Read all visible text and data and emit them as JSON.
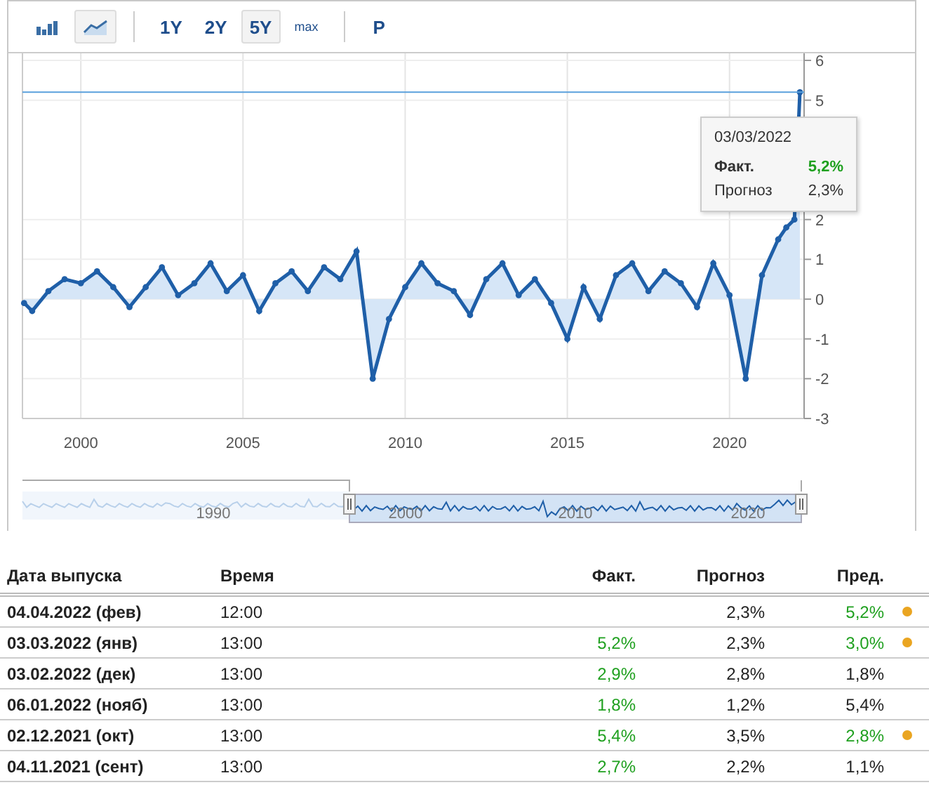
{
  "toolbar": {
    "chart_types": [
      {
        "kind": "bars",
        "selected": false
      },
      {
        "kind": "line",
        "selected": true
      }
    ],
    "ranges": [
      {
        "label": "1Y",
        "selected": false
      },
      {
        "label": "2Y",
        "selected": false
      },
      {
        "label": "5Y",
        "selected": true
      },
      {
        "label": "max",
        "selected": false,
        "kind": "small"
      }
    ],
    "extra": [
      {
        "label": "P",
        "selected": false
      }
    ]
  },
  "chart": {
    "chart_data": {
      "type": "area",
      "x": [
        1998.25,
        1998.5,
        1999,
        1999.5,
        2000,
        2000.5,
        2001,
        2001.5,
        2002,
        2002.5,
        2003,
        2003.5,
        2004,
        2004.5,
        2005,
        2005.5,
        2006,
        2006.5,
        2007,
        2007.5,
        2008,
        2008.5,
        2009,
        2009.5,
        2010,
        2010.5,
        2011,
        2011.5,
        2012,
        2012.5,
        2013,
        2013.5,
        2014,
        2014.5,
        2015,
        2015.5,
        2016,
        2016.5,
        2017,
        2017.5,
        2018,
        2018.5,
        2019,
        2019.5,
        2020,
        2020.5,
        2021,
        2021.5,
        2021.75,
        2022,
        2022.17
      ],
      "series": [
        {
          "color": "#1f5fa8",
          "values": [
            -0.1,
            -0.3,
            0.2,
            0.5,
            0.4,
            0.7,
            0.3,
            -0.2,
            0.3,
            0.8,
            0.1,
            0.4,
            0.9,
            0.2,
            0.6,
            -0.3,
            0.4,
            0.7,
            0.2,
            0.8,
            0.5,
            1.2,
            -2.0,
            -0.5,
            0.3,
            0.9,
            0.4,
            0.2,
            -0.4,
            0.5,
            0.9,
            0.1,
            0.5,
            -0.1,
            -1.0,
            0.3,
            -0.5,
            0.6,
            0.9,
            0.2,
            0.7,
            0.4,
            -0.2,
            0.9,
            0.1,
            -2.0,
            0.6,
            1.5,
            1.8,
            2.0,
            5.2
          ]
        }
      ],
      "xlim": [
        1998.2,
        2022.3
      ],
      "ylim": [
        -3,
        6
      ],
      "xticks": [
        2000,
        2005,
        2010,
        2015,
        2020
      ],
      "yticks": [
        -3,
        -2,
        -1,
        0,
        1,
        2,
        5,
        6
      ],
      "grid": true
    },
    "tooltip": {
      "date": "03/03/2022",
      "rows": [
        {
          "label": "Факт.",
          "value": "5,2%",
          "kind": "actual"
        },
        {
          "label": "Прогноз",
          "value": "2,3%",
          "kind": "forecast"
        }
      ]
    }
  },
  "navigator": {
    "labels": [
      "1990",
      "2000",
      "2010",
      "2020"
    ]
  },
  "table": {
    "columns": [
      "Дата выпуска",
      "Время",
      "Факт.",
      "Прогноз",
      "Пред."
    ],
    "rows": [
      {
        "date": "04.04.2022 (фев)",
        "time": "12:00",
        "actual": "",
        "forecast": "2,3%",
        "previous": "5,2%",
        "previous_better": true,
        "revised": true
      },
      {
        "date": "03.03.2022 (янв)",
        "time": "13:00",
        "actual": "5,2%",
        "actual_better": true,
        "forecast": "2,3%",
        "previous": "3,0%",
        "previous_better": true,
        "revised": true
      },
      {
        "date": "03.02.2022 (дек)",
        "time": "13:00",
        "actual": "2,9%",
        "actual_better": true,
        "forecast": "2,8%",
        "previous": "1,8%",
        "previous_better": false,
        "revised": false
      },
      {
        "date": "06.01.2022 (нояб)",
        "time": "13:00",
        "actual": "1,8%",
        "actual_better": true,
        "forecast": "1,2%",
        "previous": "5,4%",
        "previous_better": false,
        "revised": false
      },
      {
        "date": "02.12.2021 (окт)",
        "time": "13:00",
        "actual": "5,4%",
        "actual_better": true,
        "forecast": "3,5%",
        "previous": "2,8%",
        "previous_better": true,
        "revised": true
      },
      {
        "date": "04.11.2021 (сент)",
        "time": "13:00",
        "actual": "2,7%",
        "actual_better": true,
        "forecast": "2,2%",
        "previous": "1,1%",
        "previous_better": false,
        "revised": false
      }
    ]
  }
}
